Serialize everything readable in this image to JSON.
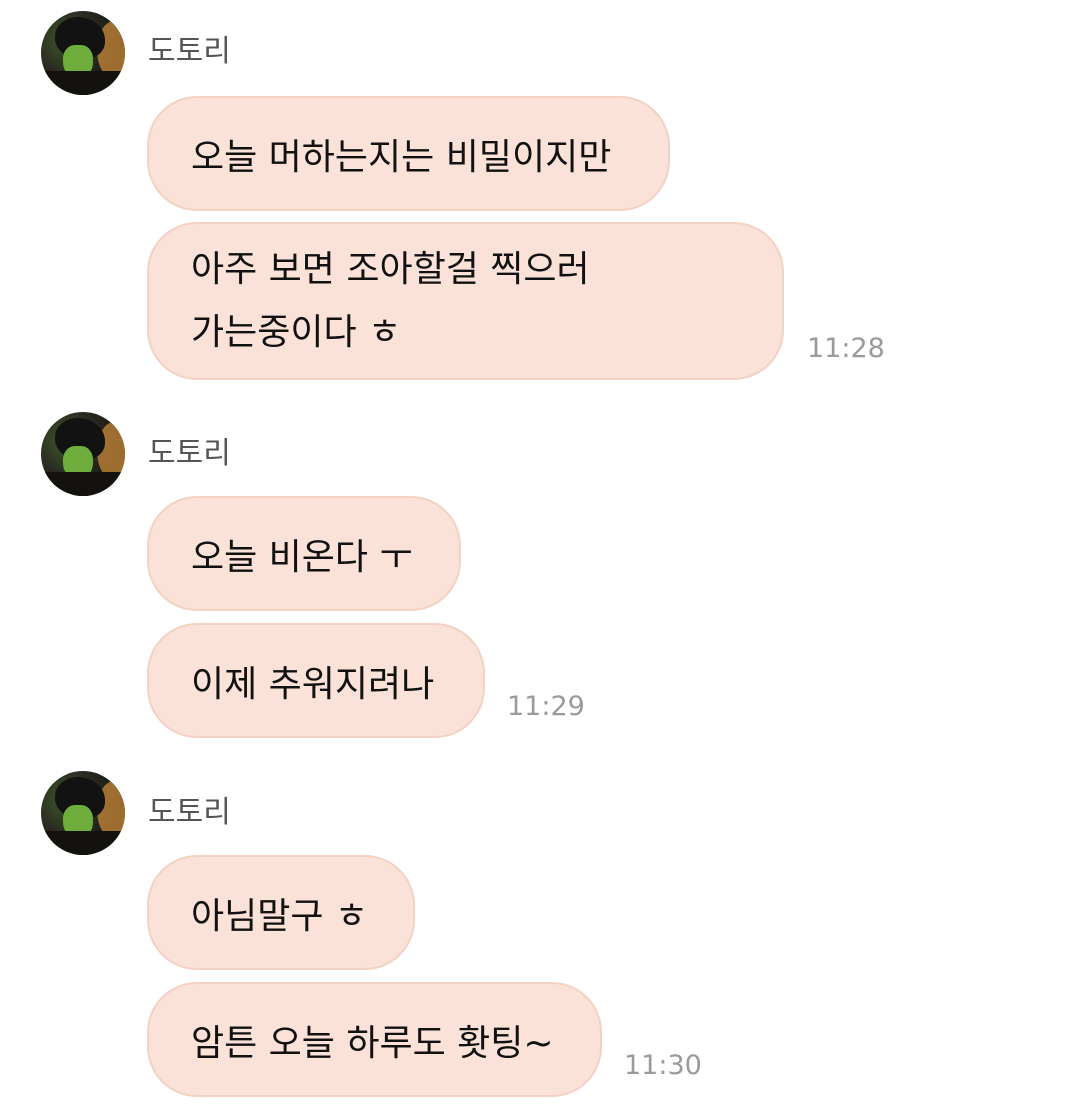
{
  "chat": {
    "groups": [
      {
        "sender": "도토리",
        "messages": [
          {
            "text": "오늘 머하는지는 비밀이지만"
          },
          {
            "text": "아주 보면 조아할걸 찍으러\n가는중이다 ㅎ"
          }
        ],
        "time": "11:28"
      },
      {
        "sender": "도토리",
        "messages": [
          {
            "text": "오늘 비온다 ㅜ"
          },
          {
            "text": "이제 추워지려나"
          }
        ],
        "time": "11:29"
      },
      {
        "sender": "도토리",
        "messages": [
          {
            "text": "아님말구 ㅎ"
          },
          {
            "text": "암튼 오늘 하루도 홧팅~"
          }
        ],
        "time": "11:30"
      }
    ]
  },
  "colors": {
    "bubble_background": "#fae2d8",
    "bubble_border": "#f3d2c3",
    "sender_text": "#555555",
    "timestamp_text": "#9a9a9a"
  },
  "icons": {
    "avatar": "profile-avatar"
  }
}
